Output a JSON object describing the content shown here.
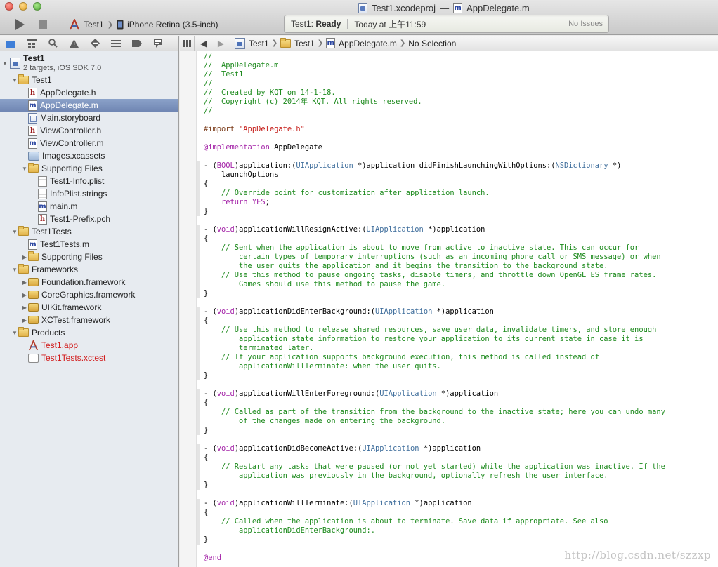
{
  "window": {
    "title_project": "Test1.xcodeproj",
    "title_separator": "—",
    "title_file": "AppDelegate.m"
  },
  "toolbar": {
    "scheme": "Test1",
    "destination": "iPhone Retina (3.5-inch)"
  },
  "activity": {
    "project": "Test1: ",
    "status": "Ready",
    "time": "Today at 上午11:59",
    "issues": "No Issues"
  },
  "navigator": {
    "project": {
      "name": "Test1",
      "subtitle": "2 targets, iOS SDK 7.0"
    },
    "rows": [
      {
        "label": "Test1",
        "icon": "folder",
        "indent": 1,
        "disclosure": "open"
      },
      {
        "label": "AppDelegate.h",
        "icon": "h",
        "indent": 2
      },
      {
        "label": "AppDelegate.m",
        "icon": "m",
        "indent": 2,
        "selected": true
      },
      {
        "label": "Main.storyboard",
        "icon": "storyboard",
        "indent": 2
      },
      {
        "label": "ViewController.h",
        "icon": "h",
        "indent": 2
      },
      {
        "label": "ViewController.m",
        "icon": "m",
        "indent": 2
      },
      {
        "label": "Images.xcassets",
        "icon": "xcassets",
        "indent": 2
      },
      {
        "label": "Supporting Files",
        "icon": "folder",
        "indent": 2,
        "disclosure": "open"
      },
      {
        "label": "Test1-Info.plist",
        "icon": "plist",
        "indent": 3
      },
      {
        "label": "InfoPlist.strings",
        "icon": "plist",
        "indent": 3
      },
      {
        "label": "main.m",
        "icon": "m",
        "indent": 3
      },
      {
        "label": "Test1-Prefix.pch",
        "icon": "h",
        "indent": 3
      },
      {
        "label": "Test1Tests",
        "icon": "folder",
        "indent": 1,
        "disclosure": "open"
      },
      {
        "label": "Test1Tests.m",
        "icon": "m",
        "indent": 2
      },
      {
        "label": "Supporting Files",
        "icon": "folder",
        "indent": 2,
        "disclosure": "closed"
      },
      {
        "label": "Frameworks",
        "icon": "folder",
        "indent": 1,
        "disclosure": "open"
      },
      {
        "label": "Foundation.framework",
        "icon": "framework",
        "indent": 2,
        "disclosure": "closed"
      },
      {
        "label": "CoreGraphics.framework",
        "icon": "framework",
        "indent": 2,
        "disclosure": "closed"
      },
      {
        "label": "UIKit.framework",
        "icon": "framework",
        "indent": 2,
        "disclosure": "closed"
      },
      {
        "label": "XCTest.framework",
        "icon": "framework",
        "indent": 2,
        "disclosure": "closed"
      },
      {
        "label": "Products",
        "icon": "folder",
        "indent": 1,
        "disclosure": "open"
      },
      {
        "label": "Test1.app",
        "icon": "app",
        "indent": 2,
        "missing": true
      },
      {
        "label": "Test1Tests.xctest",
        "icon": "xctest",
        "indent": 2,
        "missing": true
      }
    ]
  },
  "jumpbar": {
    "items": [
      "Test1",
      "Test1",
      "AppDelegate.m",
      "No Selection"
    ]
  },
  "editor": {
    "lines": [
      [
        [
          "c",
          "//"
        ]
      ],
      [
        [
          "c",
          "//  AppDelegate.m"
        ]
      ],
      [
        [
          "c",
          "//  Test1"
        ]
      ],
      [
        [
          "c",
          "//"
        ]
      ],
      [
        [
          "c",
          "//  Created by KQT on 14-1-18."
        ]
      ],
      [
        [
          "c",
          "//  Copyright (c) 2014年 KQT. All rights reserved."
        ]
      ],
      [
        [
          "c",
          "//"
        ]
      ],
      [],
      [
        [
          "p",
          "#import "
        ],
        [
          "s",
          "\"AppDelegate.h\""
        ]
      ],
      [],
      [
        [
          "k",
          "@implementation"
        ],
        [
          "",
          " AppDelegate"
        ]
      ],
      [],
      [
        [
          "",
          "- ("
        ],
        [
          "k",
          "BOOL"
        ],
        [
          "",
          ")application:("
        ],
        [
          "t",
          "UIApplication"
        ],
        [
          "",
          " *)application didFinishLaunchingWithOptions:("
        ],
        [
          "t",
          "NSDictionary"
        ],
        [
          "",
          " *)"
        ]
      ],
      [
        [
          "",
          "    launchOptions"
        ]
      ],
      [
        [
          "",
          "{"
        ]
      ],
      [
        [
          "c",
          "    // Override point for customization after application launch."
        ]
      ],
      [
        [
          "",
          "    "
        ],
        [
          "k",
          "return"
        ],
        [
          "",
          " "
        ],
        [
          "k",
          "YES"
        ],
        [
          "",
          ";"
        ]
      ],
      [
        [
          "",
          "}"
        ]
      ],
      [],
      [
        [
          "",
          "- ("
        ],
        [
          "k",
          "void"
        ],
        [
          "",
          ")applicationWillResignActive:("
        ],
        [
          "t",
          "UIApplication"
        ],
        [
          "",
          " *)application"
        ]
      ],
      [
        [
          "",
          "{"
        ]
      ],
      [
        [
          "c",
          "    // Sent when the application is about to move from active to inactive state. This can occur for"
        ]
      ],
      [
        [
          "c",
          "        certain types of temporary interruptions (such as an incoming phone call or SMS message) or when"
        ]
      ],
      [
        [
          "c",
          "        the user quits the application and it begins the transition to the background state."
        ]
      ],
      [
        [
          "c",
          "    // Use this method to pause ongoing tasks, disable timers, and throttle down OpenGL ES frame rates."
        ]
      ],
      [
        [
          "c",
          "        Games should use this method to pause the game."
        ]
      ],
      [
        [
          "",
          "}"
        ]
      ],
      [],
      [
        [
          "",
          "- ("
        ],
        [
          "k",
          "void"
        ],
        [
          "",
          ")applicationDidEnterBackground:("
        ],
        [
          "t",
          "UIApplication"
        ],
        [
          "",
          " *)application"
        ]
      ],
      [
        [
          "",
          "{"
        ]
      ],
      [
        [
          "c",
          "    // Use this method to release shared resources, save user data, invalidate timers, and store enough"
        ]
      ],
      [
        [
          "c",
          "        application state information to restore your application to its current state in case it is"
        ]
      ],
      [
        [
          "c",
          "        terminated later."
        ]
      ],
      [
        [
          "c",
          "    // If your application supports background execution, this method is called instead of"
        ]
      ],
      [
        [
          "c",
          "        applicationWillTerminate: when the user quits."
        ]
      ],
      [
        [
          "",
          "}"
        ]
      ],
      [],
      [
        [
          "",
          "- ("
        ],
        [
          "k",
          "void"
        ],
        [
          "",
          ")applicationWillEnterForeground:("
        ],
        [
          "t",
          "UIApplication"
        ],
        [
          "",
          " *)application"
        ]
      ],
      [
        [
          "",
          "{"
        ]
      ],
      [
        [
          "c",
          "    // Called as part of the transition from the background to the inactive state; here you can undo many"
        ]
      ],
      [
        [
          "c",
          "        of the changes made on entering the background."
        ]
      ],
      [
        [
          "",
          "}"
        ]
      ],
      [],
      [
        [
          "",
          "- ("
        ],
        [
          "k",
          "void"
        ],
        [
          "",
          ")applicationDidBecomeActive:("
        ],
        [
          "t",
          "UIApplication"
        ],
        [
          "",
          " *)application"
        ]
      ],
      [
        [
          "",
          "{"
        ]
      ],
      [
        [
          "c",
          "    // Restart any tasks that were paused (or not yet started) while the application was inactive. If the"
        ]
      ],
      [
        [
          "c",
          "        application was previously in the background, optionally refresh the user interface."
        ]
      ],
      [
        [
          "",
          "}"
        ]
      ],
      [],
      [
        [
          "",
          "- ("
        ],
        [
          "k",
          "void"
        ],
        [
          "",
          ")applicationWillTerminate:("
        ],
        [
          "t",
          "UIApplication"
        ],
        [
          "",
          " *)application"
        ]
      ],
      [
        [
          "",
          "{"
        ]
      ],
      [
        [
          "c",
          "    // Called when the application is about to terminate. Save data if appropriate. See also"
        ]
      ],
      [
        [
          "c",
          "        applicationDidEnterBackground:."
        ]
      ],
      [
        [
          "",
          "}"
        ]
      ],
      [],
      [
        [
          "k",
          "@end"
        ]
      ]
    ],
    "watermark": "http://blog.csdn.net/szzxp"
  },
  "colors": {
    "comment": "#1d8a1d",
    "string": "#c41a16",
    "keyword": "#a424a8",
    "type": "#3f6e9c",
    "selection": "#7a8fbc",
    "missing_file": "#d21a1a"
  }
}
